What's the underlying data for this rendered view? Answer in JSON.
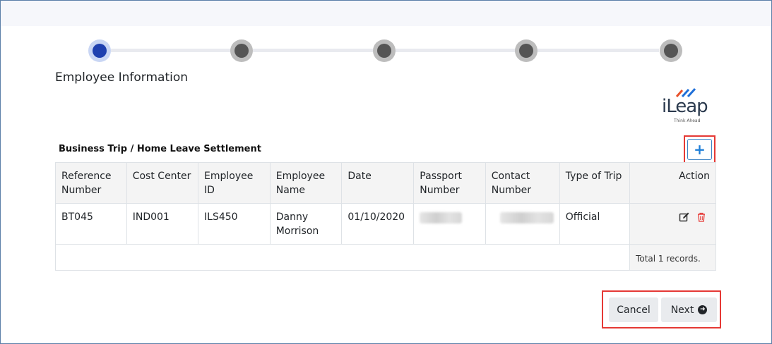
{
  "stepper": {
    "steps": [
      {
        "state": "active"
      },
      {
        "state": "pending"
      },
      {
        "state": "pending"
      },
      {
        "state": "pending"
      },
      {
        "state": "pending"
      }
    ]
  },
  "section_title": "Employee Information",
  "logo": {
    "word": "iLeap",
    "tagline": "Think Ahead"
  },
  "table": {
    "caption": "Business Trip / Home Leave Settlement",
    "add_icon": "plus-icon",
    "columns": [
      "Reference Number",
      "Cost Center",
      "Employee ID",
      "Employee Name",
      "Date",
      "Passport Number",
      "Contact Number",
      "Type of Trip",
      "Action"
    ],
    "rows": [
      {
        "reference_number": "BT045",
        "cost_center": "IND001",
        "employee_id": "ILS450",
        "employee_name": "Danny Morrison",
        "date": "01/10/2020",
        "type_of_trip": "Official"
      }
    ],
    "footer_total": "Total 1 records."
  },
  "buttons": {
    "cancel_label": "Cancel",
    "next_label": "Next"
  },
  "colors": {
    "accent_blue": "#1e40af",
    "highlight_red": "#e53935",
    "delete_red": "#e53935"
  }
}
